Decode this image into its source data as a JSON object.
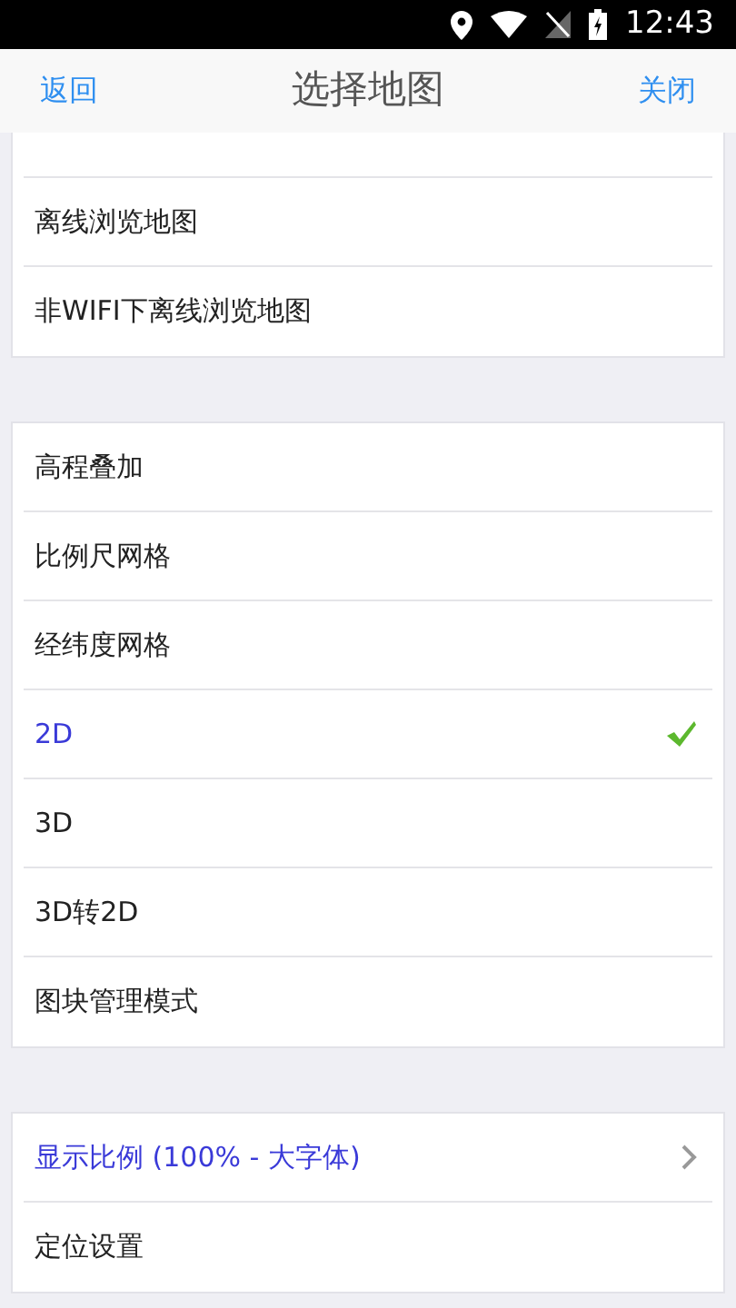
{
  "status_bar": {
    "time": "12:43"
  },
  "header": {
    "back": "返回",
    "title": "选择地图",
    "close": "关闭"
  },
  "groups": [
    {
      "partial_top": true,
      "rows": [
        {
          "kind": "option",
          "label": "离线浏览地图",
          "selected": false
        },
        {
          "kind": "option",
          "label": "非WIFI下离线浏览地图",
          "selected": false
        }
      ]
    },
    {
      "rows": [
        {
          "kind": "option",
          "label": "高程叠加",
          "selected": false
        },
        {
          "kind": "option",
          "label": "比例尺网格",
          "selected": false
        },
        {
          "kind": "option",
          "label": "经纬度网格",
          "selected": false
        },
        {
          "kind": "option",
          "label": "2D",
          "selected": true
        },
        {
          "kind": "option",
          "label": "3D",
          "selected": false
        },
        {
          "kind": "option",
          "label": "3D转2D",
          "selected": false
        },
        {
          "kind": "option",
          "label": "图块管理模式",
          "selected": false
        }
      ]
    },
    {
      "rows": [
        {
          "kind": "nav",
          "label": "显示比例 (100% - 大字体)",
          "selected": true
        },
        {
          "kind": "nav",
          "label": "定位设置",
          "selected": false,
          "chevron": false
        }
      ]
    }
  ]
}
